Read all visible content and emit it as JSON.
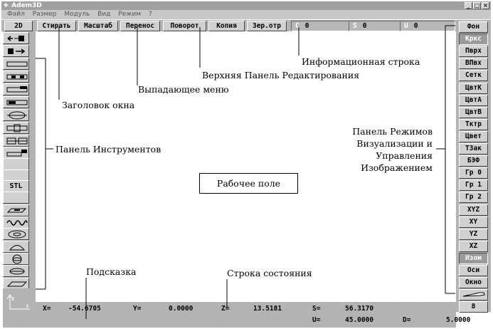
{
  "window": {
    "title": "Adem3D",
    "minimize": "_",
    "maximize": "□",
    "close": "×"
  },
  "menu": [
    "Файл",
    "Размер",
    "Модуль",
    "Вид",
    "Режим",
    "?"
  ],
  "toolbar": {
    "buttons": [
      "2D",
      "Стирать",
      "Масштаб",
      "Перенос",
      "Поворот",
      "Копия",
      "Зер.отр"
    ],
    "fields": [
      {
        "label": "C",
        "value": "0"
      },
      {
        "label": "S",
        "value": "0"
      },
      {
        "label": "U",
        "value": "0"
      }
    ]
  },
  "left_tools": [
    {
      "icon": "arrow-left-plug-icon",
      "label": ""
    },
    {
      "icon": "arrow-right-plug-icon",
      "label": ""
    },
    {
      "icon": "single-line-icon",
      "label": ""
    },
    {
      "icon": "multi-line-icon",
      "label": ""
    },
    {
      "icon": "double-line-icon",
      "label": ""
    },
    {
      "icon": "segment-icon",
      "label": ""
    },
    {
      "icon": "ellipse-line-icon",
      "label": ""
    },
    {
      "icon": "rect-line-icon",
      "label": ""
    },
    {
      "icon": "split-line-icon",
      "label": ""
    },
    {
      "icon": "step-line-icon",
      "label": ""
    },
    {
      "icon": "blank-tool",
      "label": ""
    },
    {
      "icon": "blank-tool",
      "label": ""
    },
    {
      "icon": "stl-icon",
      "label": "STL"
    },
    {
      "icon": "blank-tool",
      "label": ""
    },
    {
      "icon": "extrude-icon",
      "label": ""
    },
    {
      "icon": "spring-icon",
      "label": ""
    },
    {
      "icon": "torus-icon",
      "label": ""
    },
    {
      "icon": "dome-icon",
      "label": ""
    },
    {
      "icon": "sphere-icon",
      "label": ""
    },
    {
      "icon": "cylinder-icon",
      "label": ""
    },
    {
      "icon": "plate-icon",
      "label": ""
    },
    {
      "icon": "axes-icon",
      "label": ""
    }
  ],
  "right_panel": [
    {
      "label": "Фон",
      "pressed": false
    },
    {
      "label": "Кркс",
      "pressed": true
    },
    {
      "label": "Пврх",
      "pressed": false
    },
    {
      "label": "ВПвх",
      "pressed": false
    },
    {
      "label": "Сетк",
      "pressed": false
    },
    {
      "label": "ЦвтК",
      "pressed": false
    },
    {
      "label": "ЦвтА",
      "pressed": false
    },
    {
      "label": "ЦвтВ",
      "pressed": false
    },
    {
      "label": "Тктр",
      "pressed": false
    },
    {
      "label": "Цвет",
      "pressed": false
    },
    {
      "label": "ТЗак",
      "pressed": false
    },
    {
      "label": "БЭФ",
      "pressed": false
    },
    {
      "label": "Гр 0",
      "pressed": false
    },
    {
      "label": "Гр 1",
      "pressed": false
    },
    {
      "label": "Гр 2",
      "pressed": false
    },
    {
      "label": "XYZ",
      "pressed": false
    },
    {
      "label": "XY",
      "pressed": false
    },
    {
      "label": "YZ",
      "pressed": false
    },
    {
      "label": "XZ",
      "pressed": false
    },
    {
      "label": "Изом",
      "pressed": true
    },
    {
      "label": "Оси",
      "pressed": false
    },
    {
      "label": "Окно",
      "pressed": false
    },
    {
      "label": "",
      "pressed": false
    },
    {
      "label": "8",
      "pressed": false
    }
  ],
  "status": {
    "x_label": "X=",
    "x_value": "-54.6705",
    "y_label": "Y=",
    "y_value": "0.0000",
    "z_label": "Z=",
    "z_value": "13.5181",
    "s_label": "S=",
    "s_value": "56.3170",
    "u_label": "U=",
    "u_value": "45.0000",
    "d_label": "D=",
    "d_value": "5.0000"
  },
  "annotations": {
    "window_title": "Заголовок окна",
    "dropdown_menu": "Выпадающее меню",
    "top_edit_panel": "Верхняя Панель Редактирования",
    "info_line": "Информационная строка",
    "tools_panel": "Панель Инструментов",
    "modes_panel": [
      "Панель Режимов",
      "Визуализации и",
      "Управления",
      "Изображением"
    ],
    "work_field": "Рабочее поле",
    "hint": "Подсказка",
    "status_line": "Строка состояния"
  }
}
